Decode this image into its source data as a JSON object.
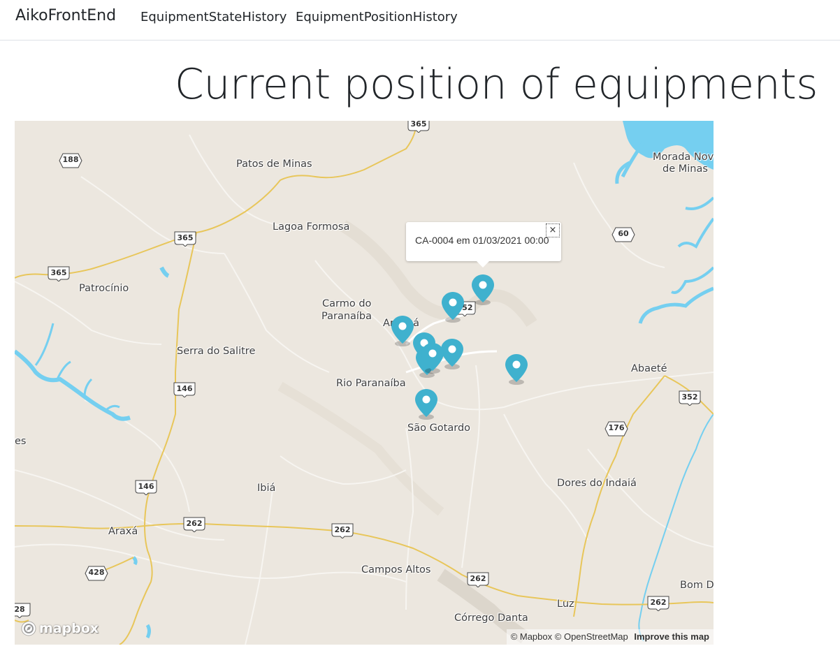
{
  "navbar": {
    "brand": "AikoFrontEnd",
    "links": [
      "EquipmentStateHistory",
      "EquipmentPositionHistory"
    ]
  },
  "page": {
    "title": "Current position of equipments"
  },
  "map": {
    "cities": [
      "Patos de Minas",
      "Lagoa Formosa",
      "Morada Nova",
      "de Minas",
      "Patrocínio",
      "Carmo do",
      "Paranaíba",
      "Arapuá",
      "Serra do Salitre",
      "Rio Paranaíba",
      "Abaeté",
      "São Gotardo",
      "es",
      "Ibiá",
      "Dores do Indaiá",
      "Araxá",
      "Campos Altos",
      "Bom D",
      "Luz",
      "Córrego Danta"
    ],
    "road_shields": [
      "365",
      "188",
      "365",
      "365",
      "60",
      "352",
      "146",
      "352",
      "176",
      "146",
      "262",
      "262",
      "428",
      "262",
      "262",
      "28"
    ],
    "equipment_markers": 9,
    "popup": {
      "text": "CA-0004 em 01/03/2021 00:00",
      "close": "×"
    },
    "logo": "mapbox",
    "attribution": {
      "mapbox": "© Mapbox",
      "osm": "© OpenStreetMap",
      "improve": "Improve this map"
    },
    "colors": {
      "land": "#ece7df",
      "water": "#75cff0",
      "roads": "#e8c65a",
      "marker": "#3fb1ce"
    }
  }
}
